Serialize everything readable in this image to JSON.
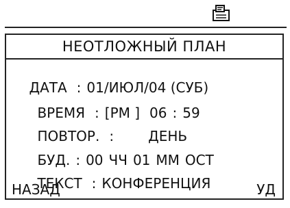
{
  "status": {
    "icon": "envelope-memo-icon"
  },
  "screen": {
    "title": "НЕОТЛОЖНЫЙ ПЛАН",
    "date": {
      "label": "ДАТА",
      "sep": ":",
      "value": "01/ИЮЛ/04 (СУБ)"
    },
    "time": {
      "label": "ВРЕМЯ",
      "sep": ":",
      "ampm": "[PM ]",
      "hour": "06",
      "colon": ":",
      "minute": "59"
    },
    "repeat": {
      "label": "ПОВТОР.",
      "sep": ":",
      "value": "ДЕНЬ"
    },
    "alarm": {
      "label": "БУД.",
      "sep": ":",
      "hours": "00",
      "hours_unit": "ЧЧ",
      "minutes": "01",
      "minutes_unit": "ММ",
      "suffix": "ОСТ"
    },
    "text": {
      "label": "ТЕКСТ",
      "sep": ":",
      "value": "КОНФЕРЕНЦИЯ"
    }
  },
  "softkeys": {
    "left": "НАЗАД",
    "right": "УД"
  }
}
